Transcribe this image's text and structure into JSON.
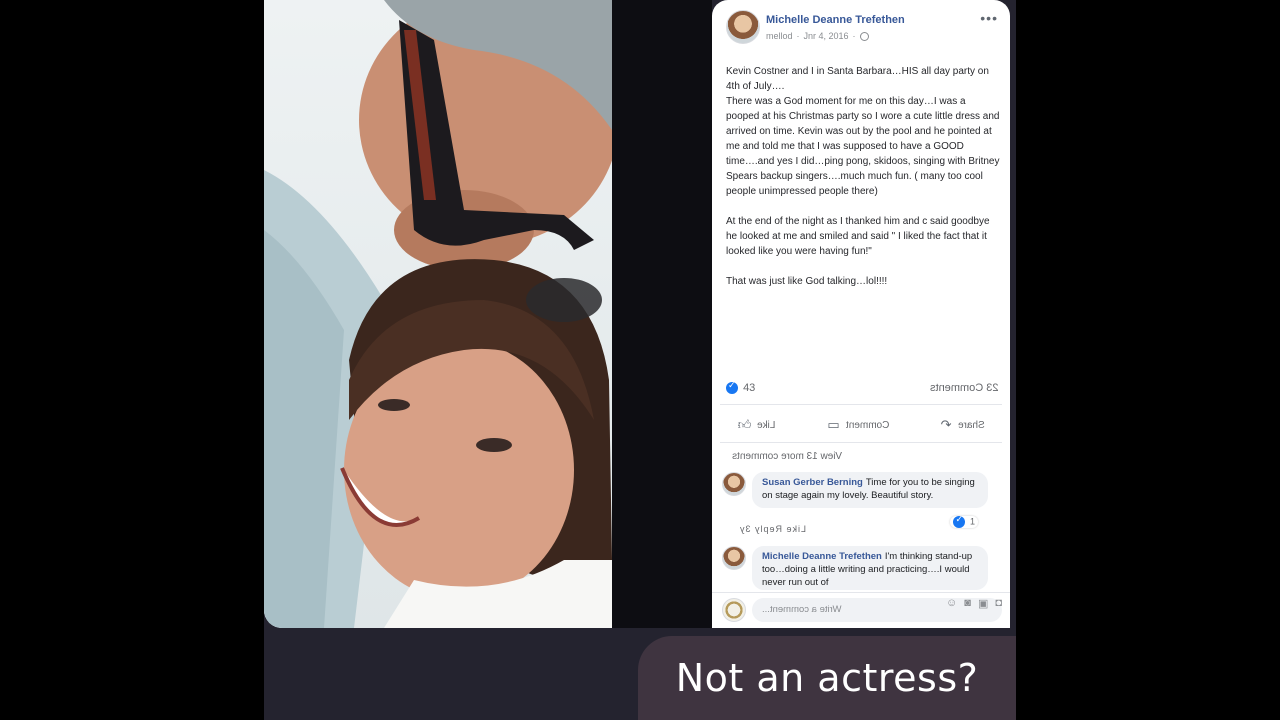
{
  "post": {
    "author": "Michelle Deanne Trefethen",
    "meta_mirrored": "mellod",
    "date": "Jnr 4, 2016",
    "more_icon": "ellipsis-icon",
    "paragraphs": [
      "Kevin Costner and I in Santa Barbara…HIS all day party on 4th of July….",
      "There was a God moment for me on this day…I was a pooped at his Christmas party so I wore a cute little dress and arrived on time. Kevin was out by the pool and he pointed at me and told me that I was supposed to have a GOOD time….and yes I did…ping pong, skidoos, singing with Britney Spears backup singers….much much fun. ( many too cool people unimpressed people there)",
      "At the end of the night as I thanked him and c said goodbye he looked at me and smiled and said \" I liked the fact that it looked like you were having fun!\"",
      "That was just like God talking…lol!!!!"
    ],
    "reactions_count": "43",
    "comments_count": "23 Comments",
    "actions": {
      "like": "Like",
      "comment": "Comment",
      "share": "Share"
    },
    "view_more": "View 13 more comments",
    "comments": [
      {
        "name": "Susan Gerber Berning",
        "text": "Time for you to be singing on stage again my lovely. Beautiful story.",
        "actions": "Like  Reply  3y",
        "reactions": "1"
      },
      {
        "name": "Michelle Deanne Trefethen",
        "text": "I'm thinking stand-up too…doing a little writing and practicing….I would never run out of"
      }
    ],
    "composer_placeholder": "Write a comment..."
  },
  "caption": "Not an actress?",
  "colors": {
    "stage_bg": "#24232f",
    "link_blue": "#385898",
    "caption_bg": "#3f3440"
  }
}
